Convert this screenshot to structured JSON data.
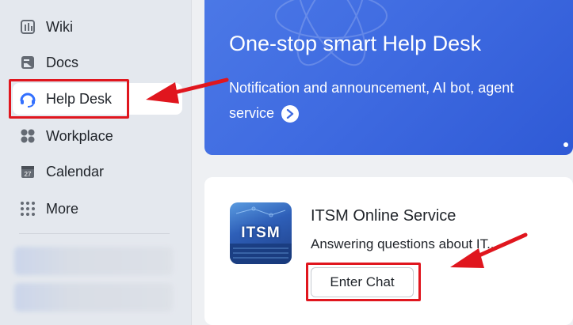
{
  "sidebar": {
    "items": [
      {
        "label": "Wiki",
        "icon": "wiki-icon"
      },
      {
        "label": "Docs",
        "icon": "docs-icon"
      },
      {
        "label": "Help Desk",
        "icon": "help-desk-icon",
        "active": true
      },
      {
        "label": "Workplace",
        "icon": "workplace-icon"
      },
      {
        "label": "Calendar",
        "icon": "calendar-icon",
        "icon_text": "27"
      },
      {
        "label": "More",
        "icon": "more-icon"
      }
    ]
  },
  "banner": {
    "title": "One-stop smart Help Desk",
    "subtitle": "Notification and announcement, AI bot, agent service"
  },
  "service_card": {
    "thumb_text": "ITSM",
    "title": "ITSM Online Service",
    "description": "Answering questions about IT...",
    "button_label": "Enter Chat"
  },
  "colors": {
    "accent_blue": "#3f6be1",
    "highlight_red": "#e0161e"
  }
}
